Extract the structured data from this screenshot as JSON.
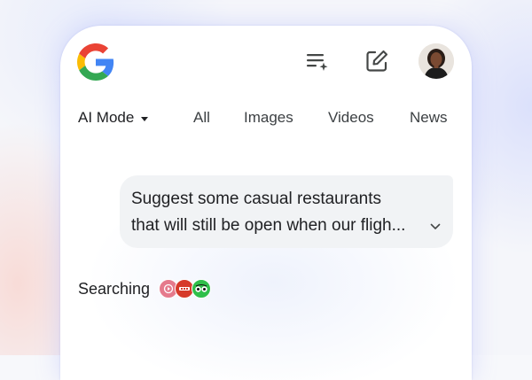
{
  "header": {
    "logo_icon": "google-g-icon",
    "history_icon": "search-history-icon",
    "edit_icon": "new-chat-edit-icon",
    "avatar": "user-avatar"
  },
  "tabs": [
    {
      "label": "AI Mode",
      "active": true,
      "has_dropdown": true
    },
    {
      "label": "All"
    },
    {
      "label": "Images"
    },
    {
      "label": "Videos"
    },
    {
      "label": "News"
    }
  ],
  "query": {
    "line1": "Suggest some casual restaurants",
    "line2": "that will still be open when our fligh...",
    "expand_icon": "chevron-down-icon"
  },
  "status": {
    "label": "Searching",
    "source_icons": [
      "source-icon-pink",
      "source-icon-red",
      "source-icon-tripadvisor"
    ]
  },
  "colors": {
    "google_blue": "#4285F4",
    "google_red": "#EA4335",
    "google_yellow": "#FBBC05",
    "google_green": "#34A853",
    "text_primary": "#202124",
    "bubble_bg": "#f1f3f5"
  }
}
